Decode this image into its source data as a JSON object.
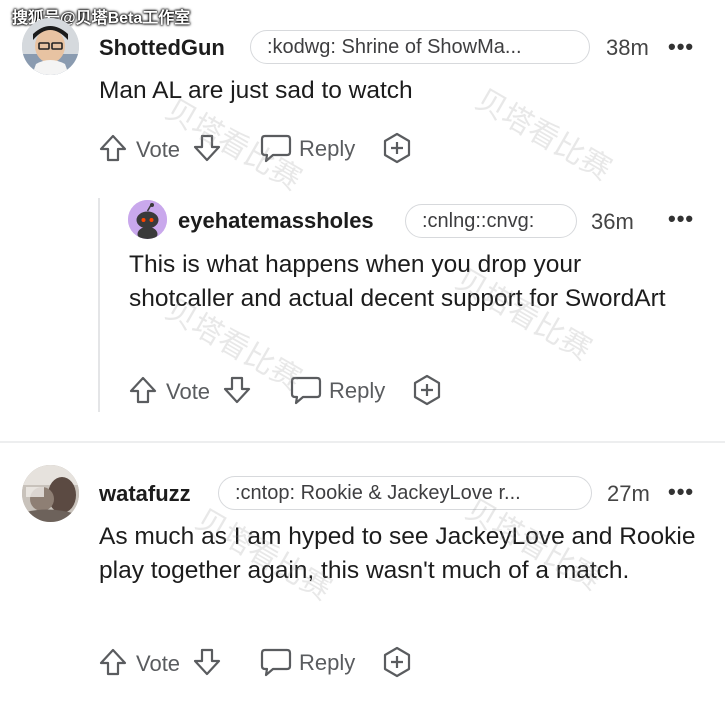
{
  "watermark": {
    "top_label": "搜狐号@贝塔Beta工作室",
    "overlay": "贝塔看比赛"
  },
  "actions": {
    "vote": "Vote",
    "reply": "Reply"
  },
  "comments": [
    {
      "username": "ShottedGun",
      "flair": ":kodwg: Shrine of ShowMa...",
      "time": "38m",
      "more": "•••",
      "body": "Man AL are just sad to watch",
      "avatar_icon": "user-avatar-photo"
    },
    {
      "username": "eyehatemassholes",
      "flair": ":cnlng::cnvg:",
      "time": "36m",
      "more": "•••",
      "body": "This is what happens when you drop your shotcaller and actual decent support for SwordArt",
      "avatar_icon": "snoo-avatar",
      "avatar_color": "#c9a8ec"
    },
    {
      "username": "watafuzz",
      "flair": ":cntop: Rookie & JackeyLove r...",
      "time": "27m",
      "more": "•••",
      "body": "As much as I am hyped to see JackeyLove and Rookie play together again, this wasn't much of a match.",
      "avatar_icon": "user-avatar-photo"
    }
  ]
}
